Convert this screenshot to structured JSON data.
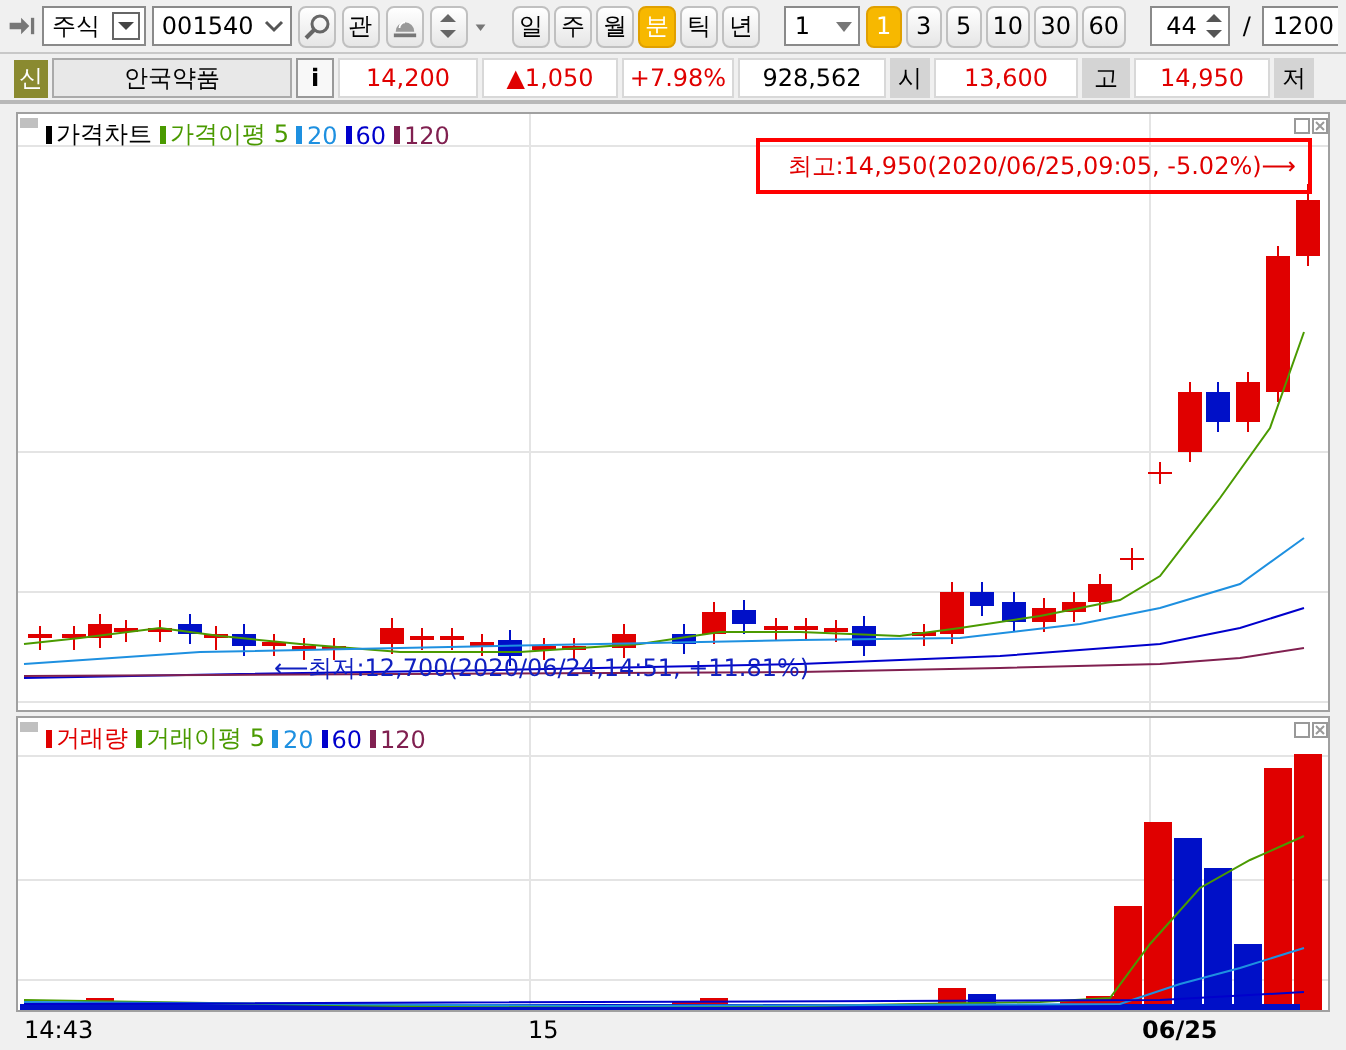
{
  "toolbar": {
    "market": "주식",
    "code": "001540",
    "watch_button": "관",
    "period_buttons": [
      {
        "label": "일",
        "selected": false
      },
      {
        "label": "주",
        "selected": false
      },
      {
        "label": "월",
        "selected": false
      },
      {
        "label": "분",
        "selected": true
      },
      {
        "label": "틱",
        "selected": false
      },
      {
        "label": "년",
        "selected": false
      }
    ],
    "interval_value": "1",
    "interval_buttons": [
      {
        "label": "1",
        "selected": true
      },
      {
        "label": "3",
        "selected": false
      },
      {
        "label": "5",
        "selected": false
      },
      {
        "label": "10",
        "selected": false
      },
      {
        "label": "30",
        "selected": false
      },
      {
        "label": "60",
        "selected": false
      }
    ],
    "count_value": "44",
    "separator": "/",
    "total_value": "1200"
  },
  "quote_bar": {
    "badge": "신",
    "name": "안국약품",
    "info_button": "i",
    "price": "14,200",
    "change": "▲1,050",
    "change_pct": "+7.98%",
    "volume": "928,562",
    "open_label": "시",
    "open": "13,600",
    "high_label": "고",
    "high": "14,950",
    "low_label": "저"
  },
  "price_panel": {
    "legend": [
      {
        "label": "가격차트",
        "color": "#000000"
      },
      {
        "label": "가격이평 5",
        "color": "#4a9a00"
      },
      {
        "label": "20",
        "color": "#1e90e0"
      },
      {
        "label": "60",
        "color": "#0000cc"
      },
      {
        "label": "120",
        "color": "#802050"
      }
    ],
    "high_annotation": "최고:14,950(2020/06/25,09:05, -5.02%)⟶",
    "low_annotation": "⟵최저:12,700(2020/06/24,14:51, +11.81%)"
  },
  "volume_panel": {
    "legend": [
      {
        "label": "거래량",
        "color": "#e00000"
      },
      {
        "label": "거래이평 5",
        "color": "#4a9a00"
      },
      {
        "label": "20",
        "color": "#1e90e0"
      },
      {
        "label": "60",
        "color": "#0000cc"
      },
      {
        "label": "120",
        "color": "#802050"
      }
    ]
  },
  "x_axis": [
    {
      "label": "14:43",
      "emphasis": false
    },
    {
      "label": "15",
      "emphasis": false
    },
    {
      "label": "06/25",
      "emphasis": true
    }
  ]
}
